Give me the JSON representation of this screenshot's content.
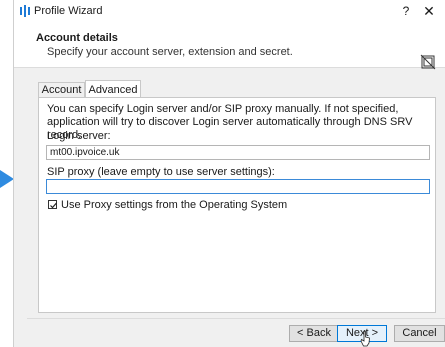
{
  "window": {
    "title": "Profile Wizard",
    "help": "?",
    "close": "✕"
  },
  "header": {
    "title": "Account details",
    "subtitle": "Specify your account server, extension and secret."
  },
  "tabs": [
    {
      "label": "Account"
    },
    {
      "label": "Advanced"
    }
  ],
  "advanced": {
    "info": "You can specify Login server and/or SIP proxy manually. If not specified, application will try to discover Login server automatically through DNS SRV record.",
    "login_label": "Login server:",
    "login_value": "mt00.ipvoice.uk",
    "sip_label": "SIP proxy (leave empty to use server settings):",
    "sip_value": "",
    "proxy_checkbox_label": "Use Proxy settings from the Operating System",
    "proxy_checked": true
  },
  "buttons": {
    "back": "< Back",
    "next": "Next >",
    "cancel": "Cancel"
  },
  "colors": {
    "accent": "#0078d7",
    "pointer_arrow": "#2f8be0"
  }
}
